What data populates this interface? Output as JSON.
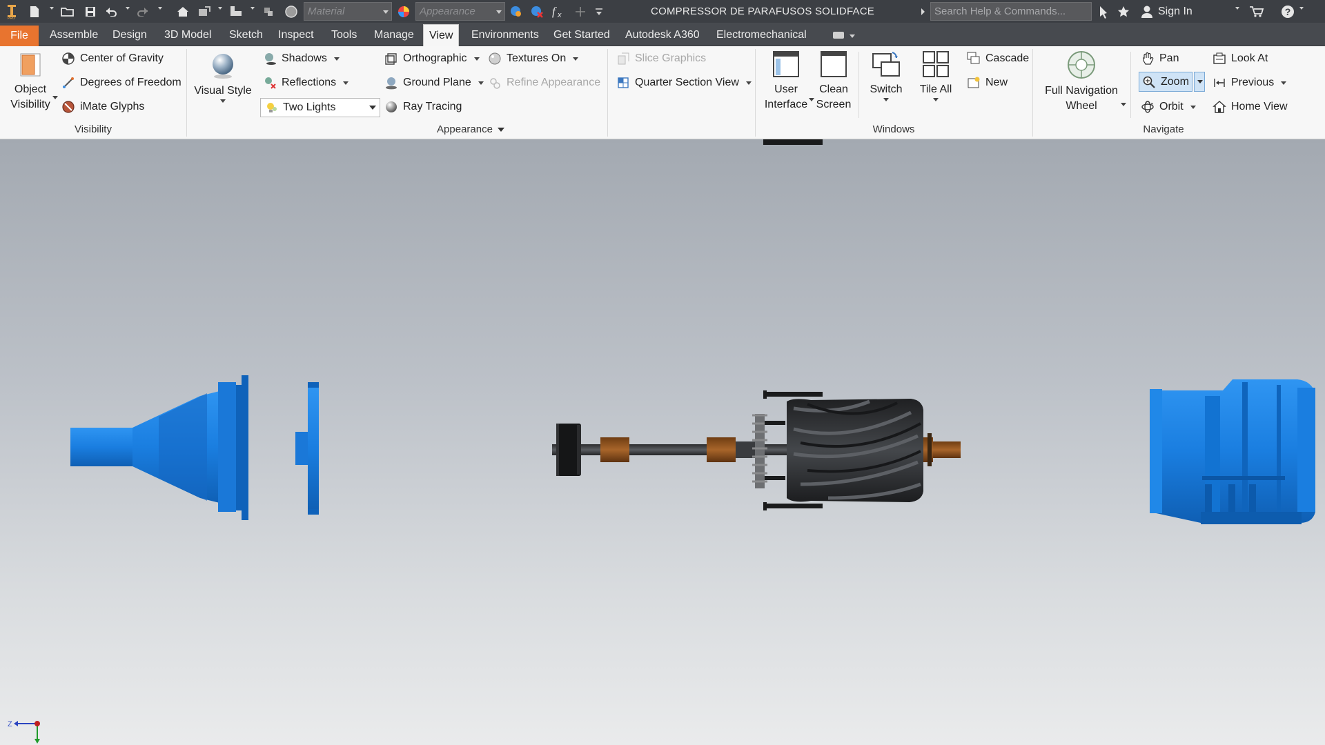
{
  "titlebar": {
    "material_placeholder": "Material",
    "appearance_placeholder": "Appearance",
    "document_title": "COMPRESSOR DE PARAFUSOS SOLIDFACE",
    "search_placeholder": "Search Help & Commands...",
    "sign_in": "Sign In"
  },
  "tabs": {
    "file": "File",
    "assemble": "Assemble",
    "design": "Design",
    "model3d": "3D Model",
    "sketch": "Sketch",
    "inspect": "Inspect",
    "tools": "Tools",
    "manage": "Manage",
    "view": "View",
    "environments": "Environments",
    "get_started": "Get Started",
    "a360": "Autodesk A360",
    "electromechanical": "Electromechanical",
    "active": "View"
  },
  "ribbon": {
    "visibility": {
      "title": "Visibility",
      "object_visibility_line1": "Object",
      "object_visibility_line2": "Visibility",
      "center_of_gravity": "Center of Gravity",
      "degrees_of_freedom": "Degrees of Freedom",
      "imate_glyphs": "iMate Glyphs"
    },
    "appearance": {
      "title": "Appearance",
      "visual_style": "Visual Style",
      "shadows": "Shadows",
      "reflections": "Reflections",
      "lighting": "Two Lights",
      "orthographic": "Orthographic",
      "ground_plane": "Ground Plane",
      "ray_tracing": "Ray Tracing",
      "textures_on": "Textures On",
      "refine_appearance": "Refine Appearance",
      "slice_graphics": "Slice Graphics",
      "quarter_section_view": "Quarter Section View"
    },
    "windows": {
      "title": "Windows",
      "user_interface_line1": "User",
      "user_interface_line2": "Interface",
      "clean_screen_line1": "Clean",
      "clean_screen_line2": "Screen",
      "switch": "Switch",
      "tile_all": "Tile All",
      "cascade": "Cascade",
      "new": "New"
    },
    "navigate": {
      "title": "Navigate",
      "full_nav_wheel_line1": "Full Navigation",
      "full_nav_wheel_line2": "Wheel",
      "pan": "Pan",
      "zoom": "Zoom",
      "orbit": "Orbit",
      "look_at": "Look At",
      "previous": "Previous",
      "home_view": "Home View"
    }
  },
  "viewport": {
    "triad_z_label": "Z"
  },
  "colors": {
    "part_blue": "#1a7ee0",
    "rotor_dark": "#2e3033",
    "bearing_bronze": "#9a5a22",
    "file_tab": "#e8742f",
    "titlebar_bg": "#3c3f44",
    "ribbon_bg": "#f7f7f7"
  }
}
